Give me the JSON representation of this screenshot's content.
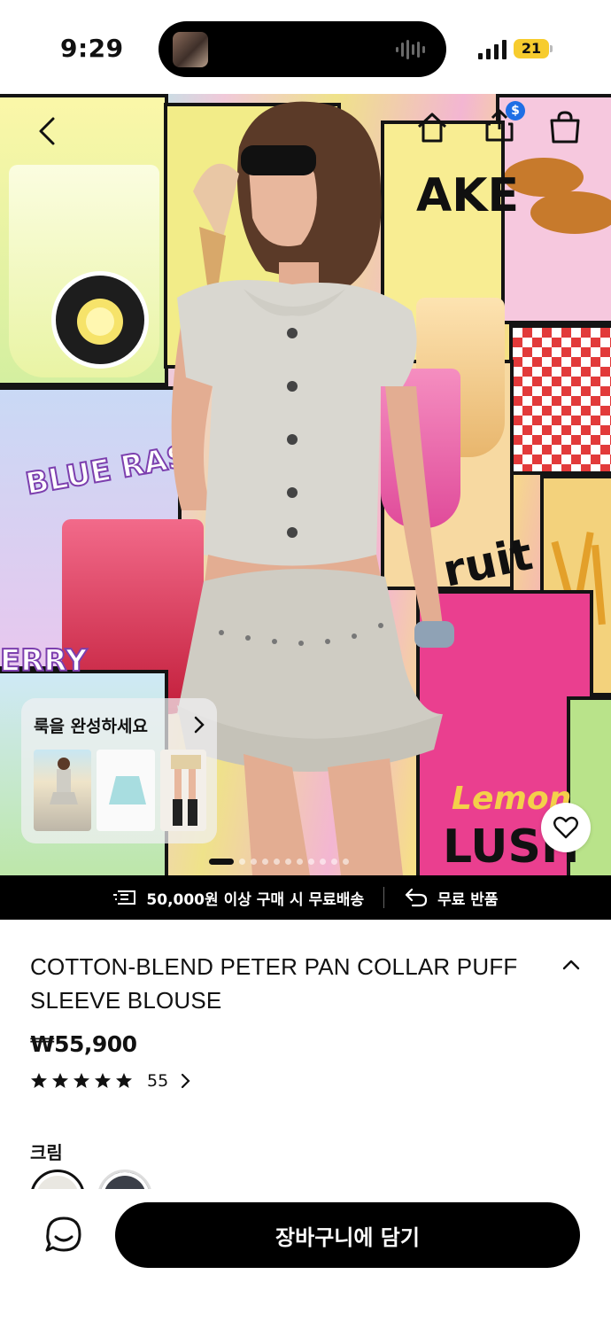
{
  "status_bar": {
    "time": "9:29",
    "battery": "21"
  },
  "nav": {
    "share_badge": "$"
  },
  "look": {
    "title": "룩을 완성하세요"
  },
  "carousel": {
    "total_dots": 11,
    "active_index": 0
  },
  "shipping": {
    "free_shipping": "50,000원 이상 구매 시 무료배송",
    "free_returns": "무료 반품"
  },
  "product": {
    "title": "COTTON-BLEND PETER PAN COLLAR PUFF SLEEVE BLOUSE",
    "price": "₩55,900",
    "rating": 5,
    "review_count": "55",
    "color_label": "크림",
    "colors": [
      {
        "name": "cream",
        "hex": "#e9e7e1",
        "selected": true
      },
      {
        "name": "navy",
        "hex": "#3b3f48",
        "selected": false
      }
    ]
  },
  "bottom": {
    "add_to_cart": "장바구니에 담기"
  },
  "poster_text": {
    "ake": "AKE",
    "blue": "BLUE RAS",
    "ruit": "ruit",
    "lemon": "Lemon",
    "lush": "LUSH",
    "erry": "ERRY"
  },
  "colors": {
    "accent": "#000000",
    "battery": "#f7cc2e",
    "share_badge": "#1f6fe5"
  }
}
